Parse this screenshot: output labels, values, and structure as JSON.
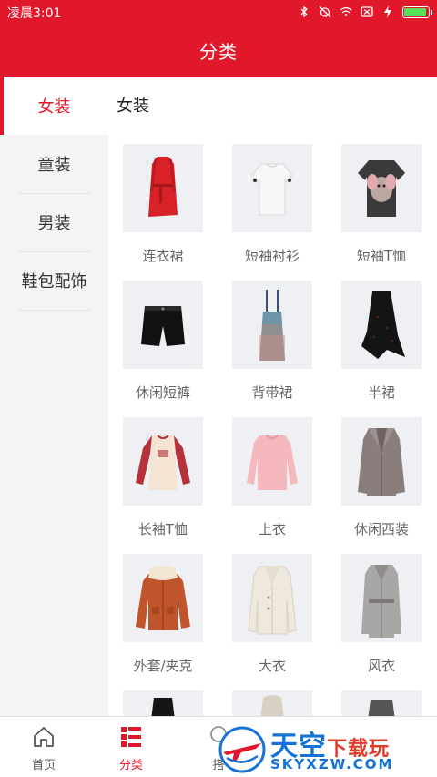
{
  "status_bar": {
    "time": "凌晨3:01",
    "icons": [
      "bluetooth-icon",
      "alarm-off-icon",
      "wifi-icon",
      "sim-icon",
      "charging-icon",
      "battery-icon"
    ],
    "battery_level": 0.95
  },
  "header": {
    "title": "分类"
  },
  "sidebar": {
    "items": [
      {
        "label": "女装",
        "active": true
      },
      {
        "label": "童装",
        "active": false
      },
      {
        "label": "男装",
        "active": false
      },
      {
        "label": "鞋包配饰",
        "active": false
      }
    ]
  },
  "content": {
    "section_title": "女装",
    "products": [
      {
        "label": "连衣裙",
        "icon": "red-dress-image"
      },
      {
        "label": "短袖衬衫",
        "icon": "white-blouse-image"
      },
      {
        "label": "短袖T恤",
        "icon": "graphic-tshirt-image"
      },
      {
        "label": "休闲短裤",
        "icon": "black-shorts-image"
      },
      {
        "label": "背带裙",
        "icon": "pinafore-dress-image"
      },
      {
        "label": "半裙",
        "icon": "black-skirt-image"
      },
      {
        "label": "长袖T恤",
        "icon": "raglan-tshirt-image"
      },
      {
        "label": "上衣",
        "icon": "pink-sweater-image"
      },
      {
        "label": "休闲西装",
        "icon": "plaid-blazer-image"
      },
      {
        "label": "外套/夹克",
        "icon": "corduroy-jacket-image"
      },
      {
        "label": "大衣",
        "icon": "cream-coat-image"
      },
      {
        "label": "风衣",
        "icon": "trench-coat-image"
      },
      {
        "label": "",
        "icon": "black-top-image"
      },
      {
        "label": "",
        "icon": "hooded-coat-image"
      },
      {
        "label": "",
        "icon": "dark-jacket-image"
      }
    ]
  },
  "bottom_nav": {
    "items": [
      {
        "label": "首页",
        "icon": "home-icon",
        "active": false
      },
      {
        "label": "分类",
        "icon": "category-icon",
        "active": true
      },
      {
        "label": "搭",
        "icon": "hanger-icon",
        "active": false
      }
    ]
  },
  "watermark": {
    "text_cn": "天空",
    "text_cn_small": "下载玩",
    "text_en": "SKYXZW.COM"
  },
  "colors": {
    "brand_red": "#e1172b",
    "sidebar_bg": "#f4f4f4",
    "thumb_bg": "#eef0f4"
  }
}
